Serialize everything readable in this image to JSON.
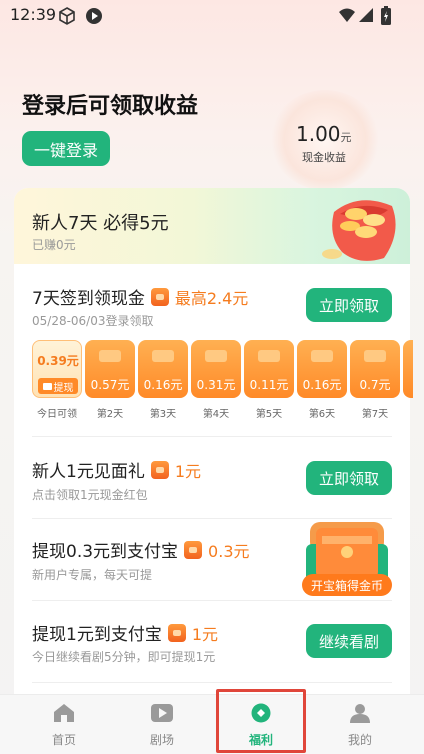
{
  "status_bar": {
    "time": "12:39"
  },
  "header": {
    "title": "登录后可领取收益",
    "login_button": "一键登录",
    "cash_amount": "1.00",
    "cash_unit": "元",
    "cash_label": "现金收益"
  },
  "banner": {
    "title": "新人7天 必得5元",
    "subtitle": "已赚0元"
  },
  "signin": {
    "title": "7天签到领现金",
    "highlight": "最高2.4元",
    "subtitle": "05/28-06/03登录领取",
    "button": "立即领取",
    "days": [
      {
        "amount": "0.39元",
        "label": "今日可领",
        "tag": "提现"
      },
      {
        "amount": "0.57元",
        "label": "第2天"
      },
      {
        "amount": "0.16元",
        "label": "第3天"
      },
      {
        "amount": "0.31元",
        "label": "第4天"
      },
      {
        "amount": "0.11元",
        "label": "第5天"
      },
      {
        "amount": "0.16元",
        "label": "第6天"
      },
      {
        "amount": "0.7元",
        "label": "第7天"
      }
    ]
  },
  "tasks": [
    {
      "title": "新人1元见面礼",
      "highlight": "1元",
      "subtitle": "点击领取1元现金红包",
      "button": "立即领取"
    },
    {
      "title": "提现0.3元到支付宝",
      "highlight": "0.3元",
      "subtitle": "新用户专属，每天可提",
      "chest_label": "开宝箱得金币"
    },
    {
      "title": "提现1元到支付宝",
      "highlight": "1元",
      "subtitle": "今日继续看剧5分钟，即可提现1元",
      "button": "继续看剧"
    }
  ],
  "tabbar": {
    "items": [
      {
        "label": "首页",
        "icon": "home-icon"
      },
      {
        "label": "剧场",
        "icon": "play-icon"
      },
      {
        "label": "福利",
        "icon": "welfare-icon",
        "active": true
      },
      {
        "label": "我的",
        "icon": "profile-icon"
      }
    ]
  },
  "colors": {
    "accent": "#22b47c",
    "orange": "#f57c1f",
    "highlight_box": "#e0463a"
  }
}
